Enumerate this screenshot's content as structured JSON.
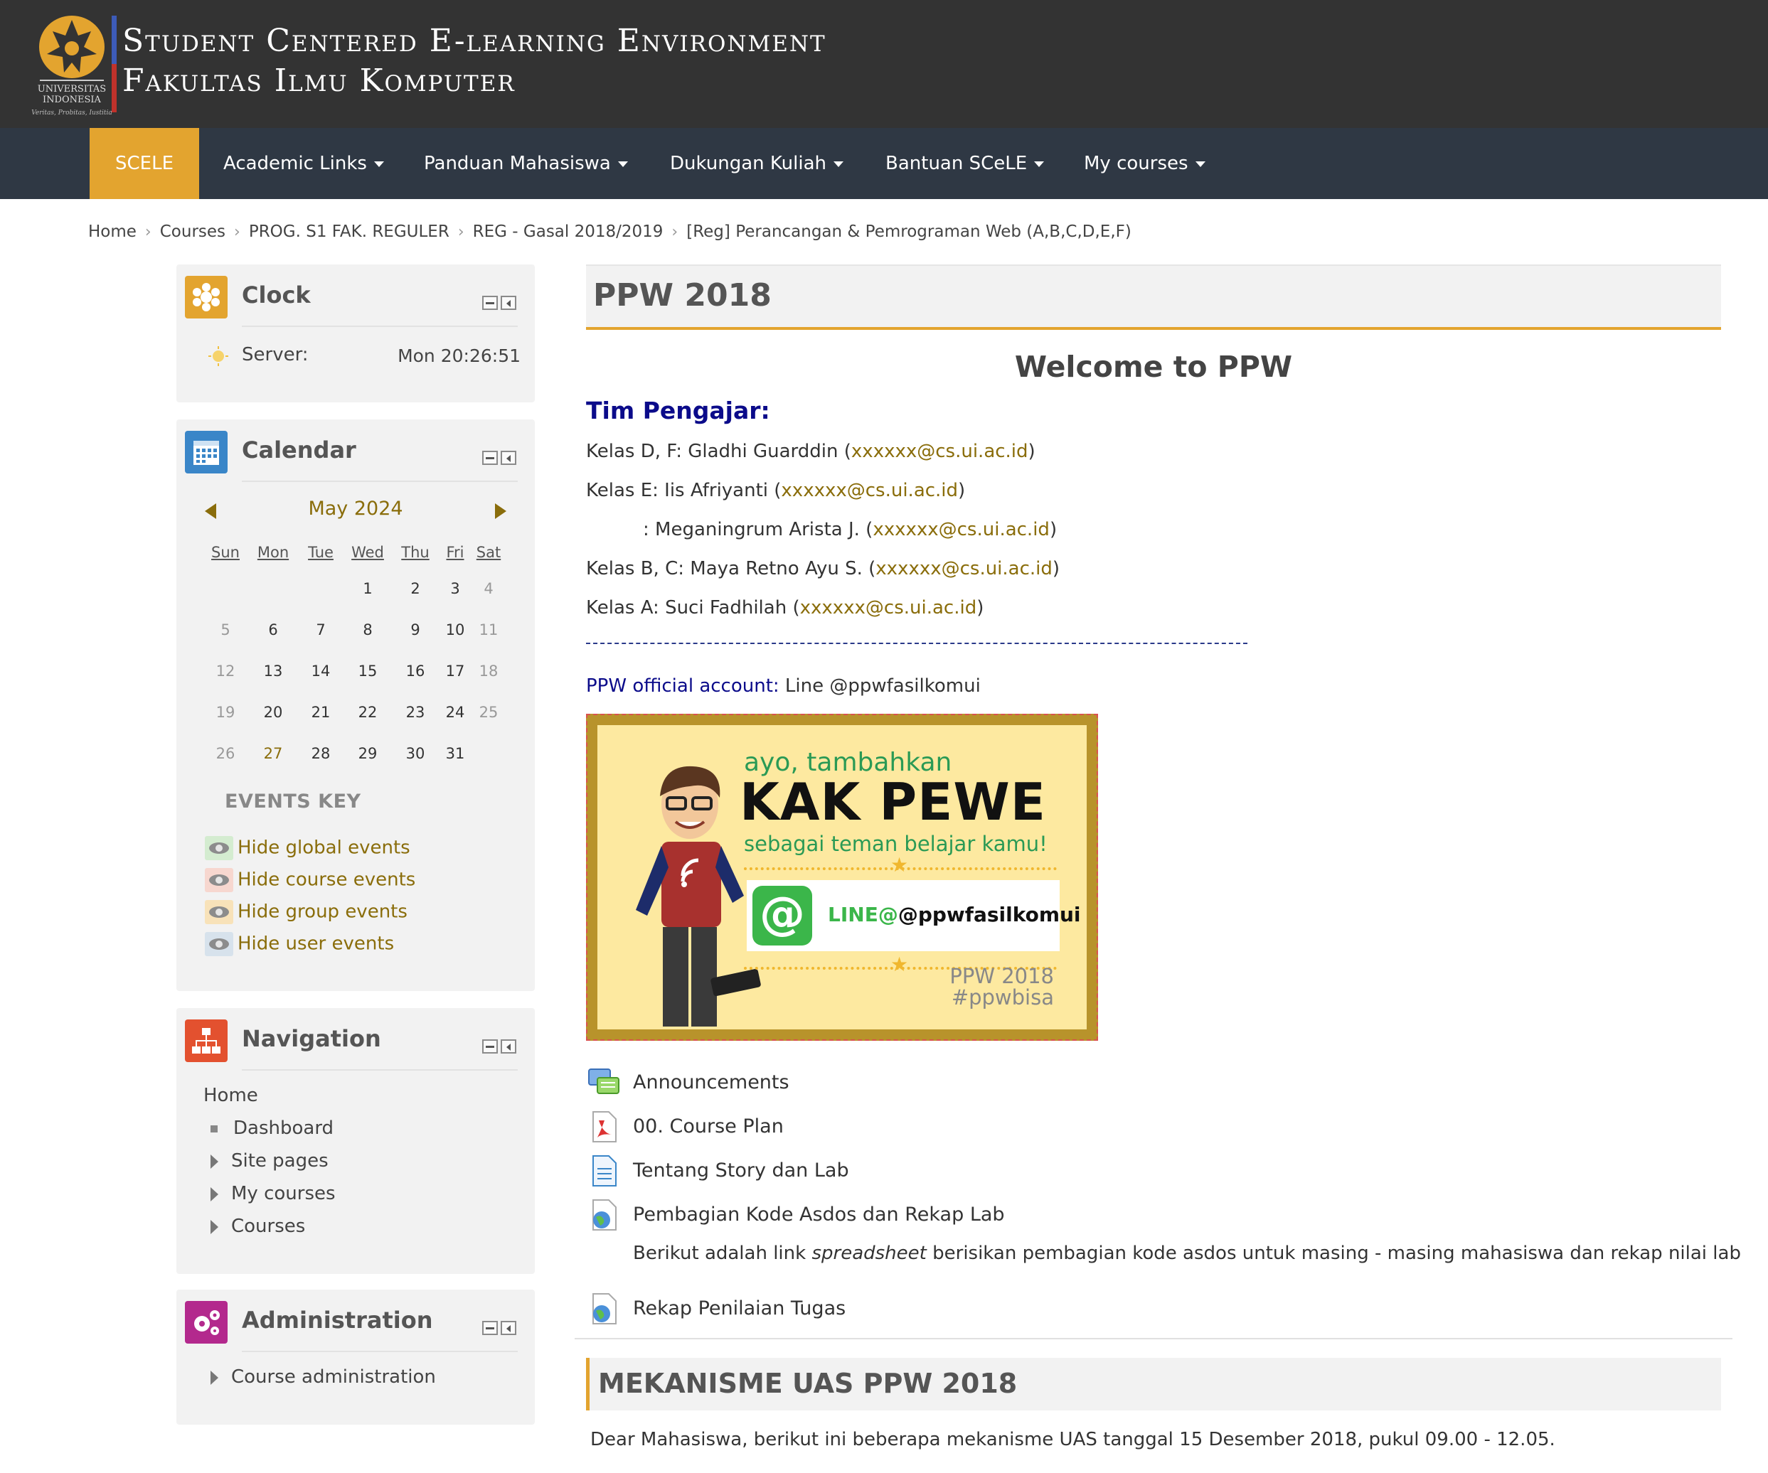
{
  "header": {
    "title_line1": "Student Centered E-learning Environment",
    "title_line2": "Fakultas Ilmu Komputer",
    "logo_text": "UNIVERSITAS INDONESIA",
    "logo_motto": "Veritas, Probitas, Iustitia"
  },
  "nav": {
    "home": "SCELE",
    "items": [
      "Academic Links",
      "Panduan Mahasiswa",
      "Dukungan Kuliah",
      "Bantuan SCeLE",
      "My courses"
    ]
  },
  "breadcrumb": [
    "Home",
    "Courses",
    "PROG. S1 FAK. REGULER",
    "REG - Gasal 2018/2019",
    "[Reg] Perancangan & Pemrograman Web (A,B,C,D,E,F)"
  ],
  "clock": {
    "title": "Clock",
    "server_label": "Server:",
    "time": "Mon 20:26:51"
  },
  "calendar": {
    "title": "Calendar",
    "month": "May 2024",
    "weekdays": [
      "Sun",
      "Mon",
      "Tue",
      "Wed",
      "Thu",
      "Fri",
      "Sat"
    ],
    "weeks": [
      [
        "",
        "",
        "",
        "1",
        "2",
        "3",
        "4"
      ],
      [
        "5",
        "6",
        "7",
        "8",
        "9",
        "10",
        "11"
      ],
      [
        "12",
        "13",
        "14",
        "15",
        "16",
        "17",
        "18"
      ],
      [
        "19",
        "20",
        "21",
        "22",
        "23",
        "24",
        "25"
      ],
      [
        "26",
        "27",
        "28",
        "29",
        "30",
        "31",
        ""
      ]
    ],
    "today": "27",
    "events_key_title": "EVENTS KEY",
    "events_key": [
      {
        "label": "Hide global events",
        "color": "#d4ecd0"
      },
      {
        "label": "Hide course events",
        "color": "#f7d7cf"
      },
      {
        "label": "Hide group events",
        "color": "#f8e2b9"
      },
      {
        "label": "Hide user events",
        "color": "#d7e2ec"
      }
    ]
  },
  "navigation": {
    "title": "Navigation",
    "home": "Home",
    "items": [
      "Dashboard",
      "Site pages",
      "My courses",
      "Courses"
    ]
  },
  "administration": {
    "title": "Administration",
    "items": [
      "Course administration"
    ]
  },
  "main": {
    "course_title": "PPW 2018",
    "welcome": "Welcome to PPW",
    "team_title": "Tim Pengajar:",
    "teachers": [
      {
        "prefix": "Kelas D, F: Gladhi Guarddin (",
        "email": "xxxxxx@cs.ui.ac.id",
        "suffix": ")"
      },
      {
        "prefix": "Kelas E: Iis Afriyanti (",
        "email": "xxxxxx@cs.ui.ac.id",
        "suffix": ")"
      },
      {
        "prefix": ": Meganingrum Arista J. (",
        "email": "xxxxxx@cs.ui.ac.id",
        "suffix": ")"
      },
      {
        "prefix": "Kelas B, C: Maya Retno Ayu S. (",
        "email": "xxxxxx@cs.ui.ac.id",
        "suffix": ")"
      },
      {
        "prefix": "Kelas A: Suci Fadhilah (",
        "email": "xxxxxx@cs.ui.ac.id",
        "suffix": ")"
      }
    ],
    "official_label": "PPW official account:",
    "official_value": "Line @ppwfasilkomui",
    "poster": {
      "line1": "ayo, tambahkan",
      "line2": "KAK PEWE",
      "line3": "sebagai teman belajar kamu!",
      "line_brand": "LINE@",
      "line_handle": "@ppwfasilkomui",
      "footer1": "PPW 2018",
      "footer2": "#ppwbisa"
    },
    "activities": [
      "Announcements",
      "00. Course Plan",
      "Tentang Story dan Lab",
      "Pembagian Kode Asdos dan Rekap Lab",
      "Rekap Penilaian Tugas"
    ],
    "activity_desc_pre": "Berikut adalah link ",
    "activity_desc_em": "spreadsheet",
    "activity_desc_post": " berisikan pembagian kode asdos untuk masing - masing mahasiswa dan rekap nilai lab",
    "section2_title": "MEKANISME UAS PPW 2018",
    "section2_text": "Dear Mahasiswa, berikut ini beberapa mekanisme UAS tanggal 15 Desember 2018, pukul 09.00 - 12.05."
  }
}
